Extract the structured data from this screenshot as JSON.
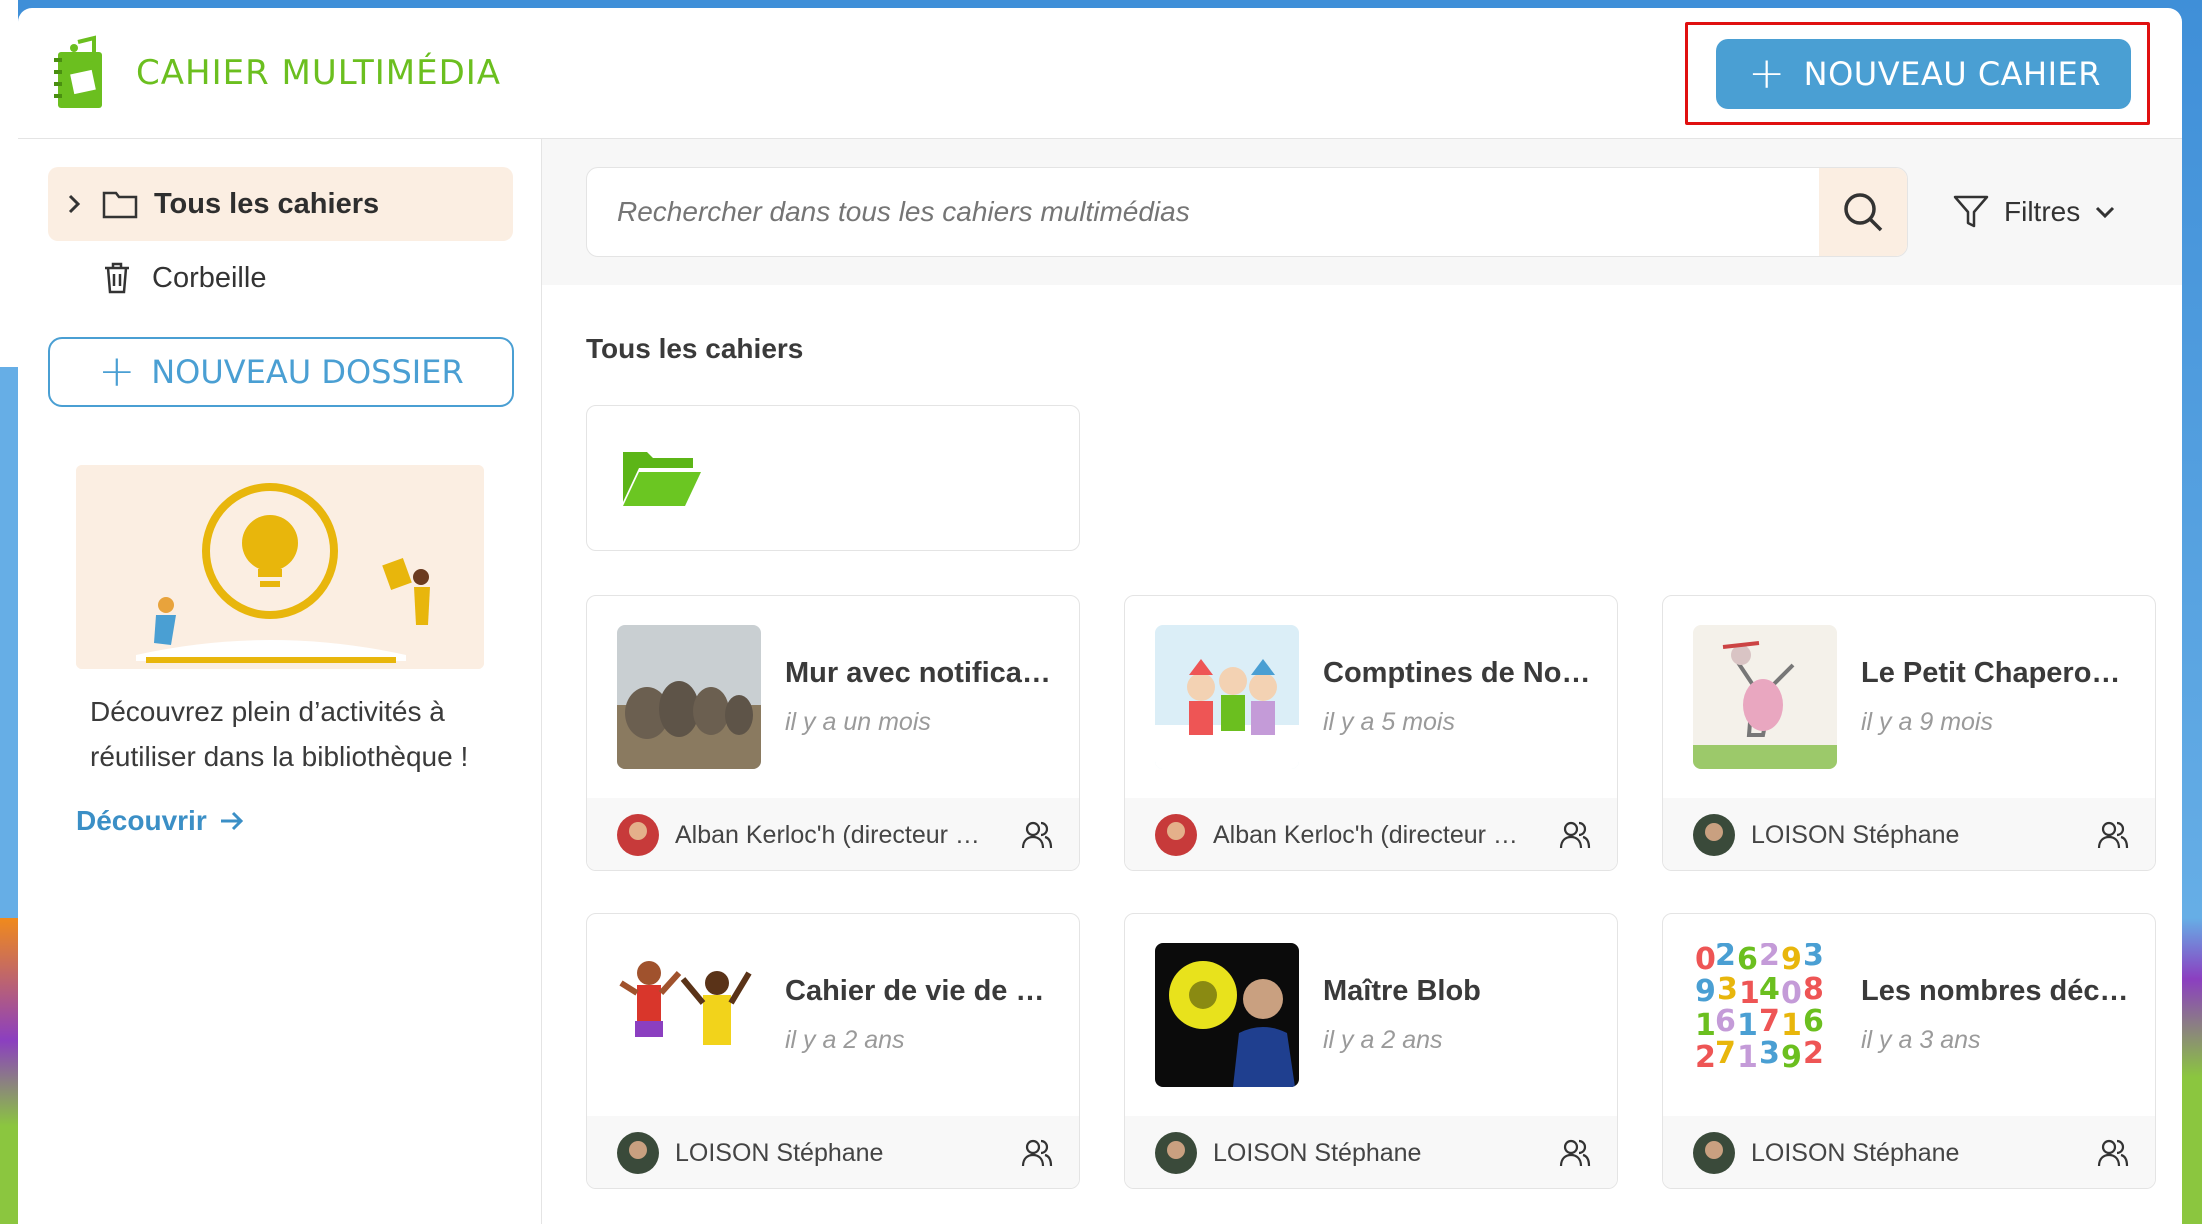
{
  "header": {
    "app_title": "CAHIER MULTIMÉDIA",
    "new_cahier_label": "NOUVEAU CAHIER"
  },
  "sidebar": {
    "items": [
      {
        "label": "Tous les cahiers"
      },
      {
        "label": "Corbeille"
      }
    ],
    "new_folder_label": "NOUVEAU DOSSIER",
    "promo": {
      "text": "Découvrez plein d’activités à réutiliser dans la bibliothèque !",
      "link": "Découvrir"
    }
  },
  "search": {
    "placeholder": "Rechercher dans tous les cahiers multimédias",
    "filters_label": "Filtres"
  },
  "main": {
    "section_title": "Tous les cahiers",
    "cards": [
      {
        "title": "Mur avec notifica…",
        "time": "il y a un mois",
        "owner": "Alban Kerloc'h (directeur …"
      },
      {
        "title": "Comptines de No…",
        "time": "il y a 5 mois",
        "owner": "Alban Kerloc'h (directeur …"
      },
      {
        "title": "Le Petit Chapero…",
        "time": "il y a 9 mois",
        "owner": "LOISON Stéphane"
      },
      {
        "title": "Cahier de vie de …",
        "time": "il y a 2 ans",
        "owner": "LOISON Stéphane"
      },
      {
        "title": "Maître Blob",
        "time": "il y a 2 ans",
        "owner": "LOISON Stéphane"
      },
      {
        "title": "Les nombres déc…",
        "time": "il y a 3 ans",
        "owner": "LOISON Stéphane"
      }
    ]
  },
  "colors": {
    "brand_green": "#6bbf1f",
    "primary_blue": "#4a9fd3",
    "highlight_red": "#e01010",
    "active_bg": "#fbeee2"
  }
}
